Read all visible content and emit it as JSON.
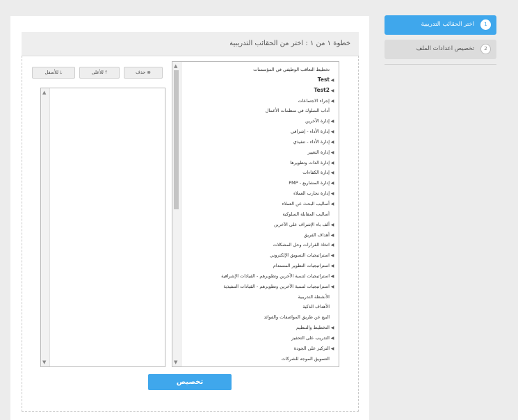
{
  "steps": [
    {
      "number": "1",
      "label": "اختر الحقائب التدريبية"
    },
    {
      "number": "2",
      "label": "تخصيص اعدادات الملف"
    }
  ],
  "panel": {
    "title": "خطوة ١ من ١ : اختر من الحقائب التدريبية"
  },
  "toolbar": {
    "delete_label": "حذف",
    "up_label": "للأعلى",
    "down_label": "للأسفل"
  },
  "customize_label": "تخصيص",
  "tree": [
    {
      "label": "تخطيط التعاقب الوظيفي في المؤسسات",
      "caret": false,
      "bold": false
    },
    {
      "label": "Test",
      "caret": true,
      "bold": true
    },
    {
      "label": "Test2",
      "caret": true,
      "bold": true
    },
    {
      "label": "إجراء الاجتماعات",
      "caret": true,
      "bold": false
    },
    {
      "label": "آداب السلوك في منظمات الأعمال",
      "caret": false,
      "bold": false
    },
    {
      "label": "إدارة الآخرين",
      "caret": true,
      "bold": false
    },
    {
      "label": "إدارة الأداء - إشرافي",
      "caret": true,
      "bold": false
    },
    {
      "label": "إدارة الأداء - تنفيذي",
      "caret": true,
      "bold": false
    },
    {
      "label": "إدارة التغيير",
      "caret": true,
      "bold": false
    },
    {
      "label": "إدارة الذات وتطويرها",
      "caret": true,
      "bold": false
    },
    {
      "label": "إدارة الكفاءات",
      "caret": true,
      "bold": false
    },
    {
      "label": "إدارة المشاريع - PMP",
      "caret": true,
      "bold": false
    },
    {
      "label": "إدارة تجارب العملاء",
      "caret": true,
      "bold": false
    },
    {
      "label": "أساليب البحث عن العملاء",
      "caret": true,
      "bold": false
    },
    {
      "label": "أساليب المقابلة السلوكية",
      "caret": false,
      "bold": false
    },
    {
      "label": "ألف باء الإشراف على الآخرين",
      "caret": true,
      "bold": false
    },
    {
      "label": "أهداف الفريق",
      "caret": true,
      "bold": false
    },
    {
      "label": "اتخاذ القرارات وحل المشكلات",
      "caret": true,
      "bold": false
    },
    {
      "label": "استراتيجيات التسويق الإلكتروني",
      "caret": true,
      "bold": false
    },
    {
      "label": "استراتيجيات التطوير المستدام",
      "caret": true,
      "bold": false
    },
    {
      "label": "استراتيجيات لتنمية الآخرين وتطويرهم - القيادات الإشرافية",
      "caret": true,
      "bold": false
    },
    {
      "label": "استراتيجيات لتنمية الآخرين وتطويرهم - القيادات التنفيذية",
      "caret": true,
      "bold": false
    },
    {
      "label": "الأنشطة التدريبية",
      "caret": false,
      "bold": false
    },
    {
      "label": "الأهداف الذكية",
      "caret": false,
      "bold": false
    },
    {
      "label": "البيع عن طريق المواصفات والفوائد",
      "caret": false,
      "bold": false
    },
    {
      "label": "التخطيط والتنظيم",
      "caret": true,
      "bold": false
    },
    {
      "label": "التدريب على التحفيز",
      "caret": true,
      "bold": false
    },
    {
      "label": "التركيز على الجودة",
      "caret": true,
      "bold": false
    },
    {
      "label": "التسويق الموجه للشركات",
      "caret": false,
      "bold": false
    }
  ]
}
